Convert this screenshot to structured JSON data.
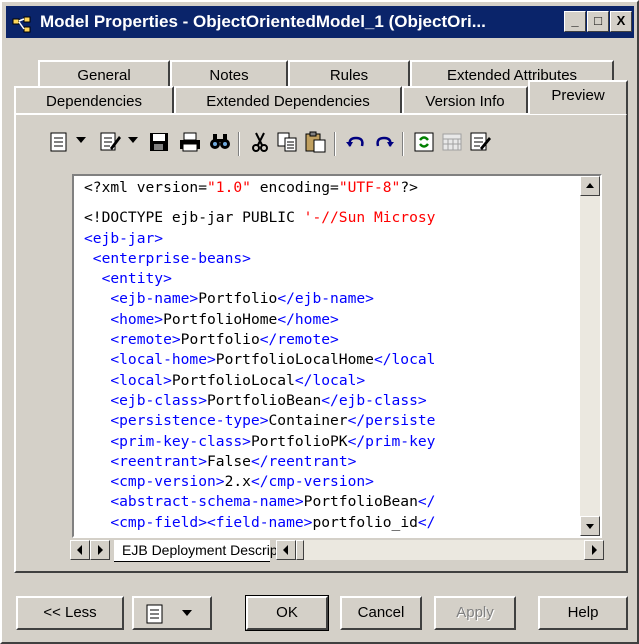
{
  "window": {
    "title": "Model Properties - ObjectOrientedModel_1 (ObjectOri...",
    "controls": [
      "_",
      "□",
      "X"
    ]
  },
  "tabs": {
    "row1": [
      "General",
      "Notes",
      "Rules",
      "Extended Attributes"
    ],
    "row2": [
      "Dependencies",
      "Extended Dependencies",
      "Version Info",
      "Preview"
    ],
    "active": "Preview"
  },
  "toolbar": {
    "icons": [
      "view-menu-icon",
      "edit-menu-icon",
      "save-icon",
      "print-icon",
      "find-icon",
      "cut-icon",
      "copy-icon",
      "paste-icon",
      "undo-icon",
      "redo-icon",
      "refresh-icon",
      "calendar-icon",
      "properties-icon"
    ]
  },
  "editor": {
    "lines": [
      [
        {
          "t": "<?xml version=",
          "c": "plain"
        },
        {
          "t": "\"1.0\"",
          "c": "str"
        },
        {
          "t": " encoding=",
          "c": "plain"
        },
        {
          "t": "\"UTF-8\"",
          "c": "str"
        },
        {
          "t": "?>",
          "c": "plain"
        }
      ],
      [],
      [
        {
          "t": "<!DOCTYPE ejb-jar PUBLIC ",
          "c": "plain"
        },
        {
          "t": "'-//Sun Microsy",
          "c": "str"
        }
      ],
      [
        {
          "t": "<ejb-jar>",
          "c": "tag"
        }
      ],
      [
        {
          "t": " <enterprise-beans>",
          "c": "tag"
        }
      ],
      [
        {
          "t": "  <entity>",
          "c": "tag"
        }
      ],
      [
        {
          "t": "   <ejb-name>",
          "c": "tag"
        },
        {
          "t": "Portfolio",
          "c": "plain"
        },
        {
          "t": "</ejb-name>",
          "c": "tag"
        }
      ],
      [
        {
          "t": "   <home>",
          "c": "tag"
        },
        {
          "t": "PortfolioHome",
          "c": "plain"
        },
        {
          "t": "</home>",
          "c": "tag"
        }
      ],
      [
        {
          "t": "   <remote>",
          "c": "tag"
        },
        {
          "t": "Portfolio",
          "c": "plain"
        },
        {
          "t": "</remote>",
          "c": "tag"
        }
      ],
      [
        {
          "t": "   <local-home>",
          "c": "tag"
        },
        {
          "t": "PortfolioLocalHome",
          "c": "plain"
        },
        {
          "t": "</local",
          "c": "tag"
        }
      ],
      [
        {
          "t": "   <local>",
          "c": "tag"
        },
        {
          "t": "PortfolioLocal",
          "c": "plain"
        },
        {
          "t": "</local>",
          "c": "tag"
        }
      ],
      [
        {
          "t": "   <ejb-class>",
          "c": "tag"
        },
        {
          "t": "PortfolioBean",
          "c": "plain"
        },
        {
          "t": "</ejb-class>",
          "c": "tag"
        }
      ],
      [
        {
          "t": "   <persistence-type>",
          "c": "tag"
        },
        {
          "t": "Container",
          "c": "plain"
        },
        {
          "t": "</persiste",
          "c": "tag"
        }
      ],
      [
        {
          "t": "   <prim-key-class>",
          "c": "tag"
        },
        {
          "t": "PortfolioPK",
          "c": "plain"
        },
        {
          "t": "</prim-key",
          "c": "tag"
        }
      ],
      [
        {
          "t": "   <reentrant>",
          "c": "tag"
        },
        {
          "t": "False",
          "c": "plain"
        },
        {
          "t": "</reentrant>",
          "c": "tag"
        }
      ],
      [
        {
          "t": "   <cmp-version>",
          "c": "tag"
        },
        {
          "t": "2.x",
          "c": "plain"
        },
        {
          "t": "</cmp-version>",
          "c": "tag"
        }
      ],
      [
        {
          "t": "   <abstract-schema-name>",
          "c": "tag"
        },
        {
          "t": "PortfolioBean",
          "c": "plain"
        },
        {
          "t": "</",
          "c": "tag"
        }
      ],
      [
        {
          "t": "   <cmp-field>",
          "c": "tag"
        },
        {
          "t": "<field-name>",
          "c": "tag"
        },
        {
          "t": "portfolio_id",
          "c": "plain"
        },
        {
          "t": "</",
          "c": "tag"
        }
      ]
    ],
    "sheet_tab": "EJB Deployment Descriptor"
  },
  "buttons": {
    "less": "<< Less",
    "ok": "OK",
    "cancel": "Cancel",
    "apply": "Apply",
    "help": "Help"
  },
  "colors": {
    "titlebar": "#0a246a",
    "tag": "#0000ff",
    "string": "#ff0000",
    "face": "#d4d0c8"
  }
}
